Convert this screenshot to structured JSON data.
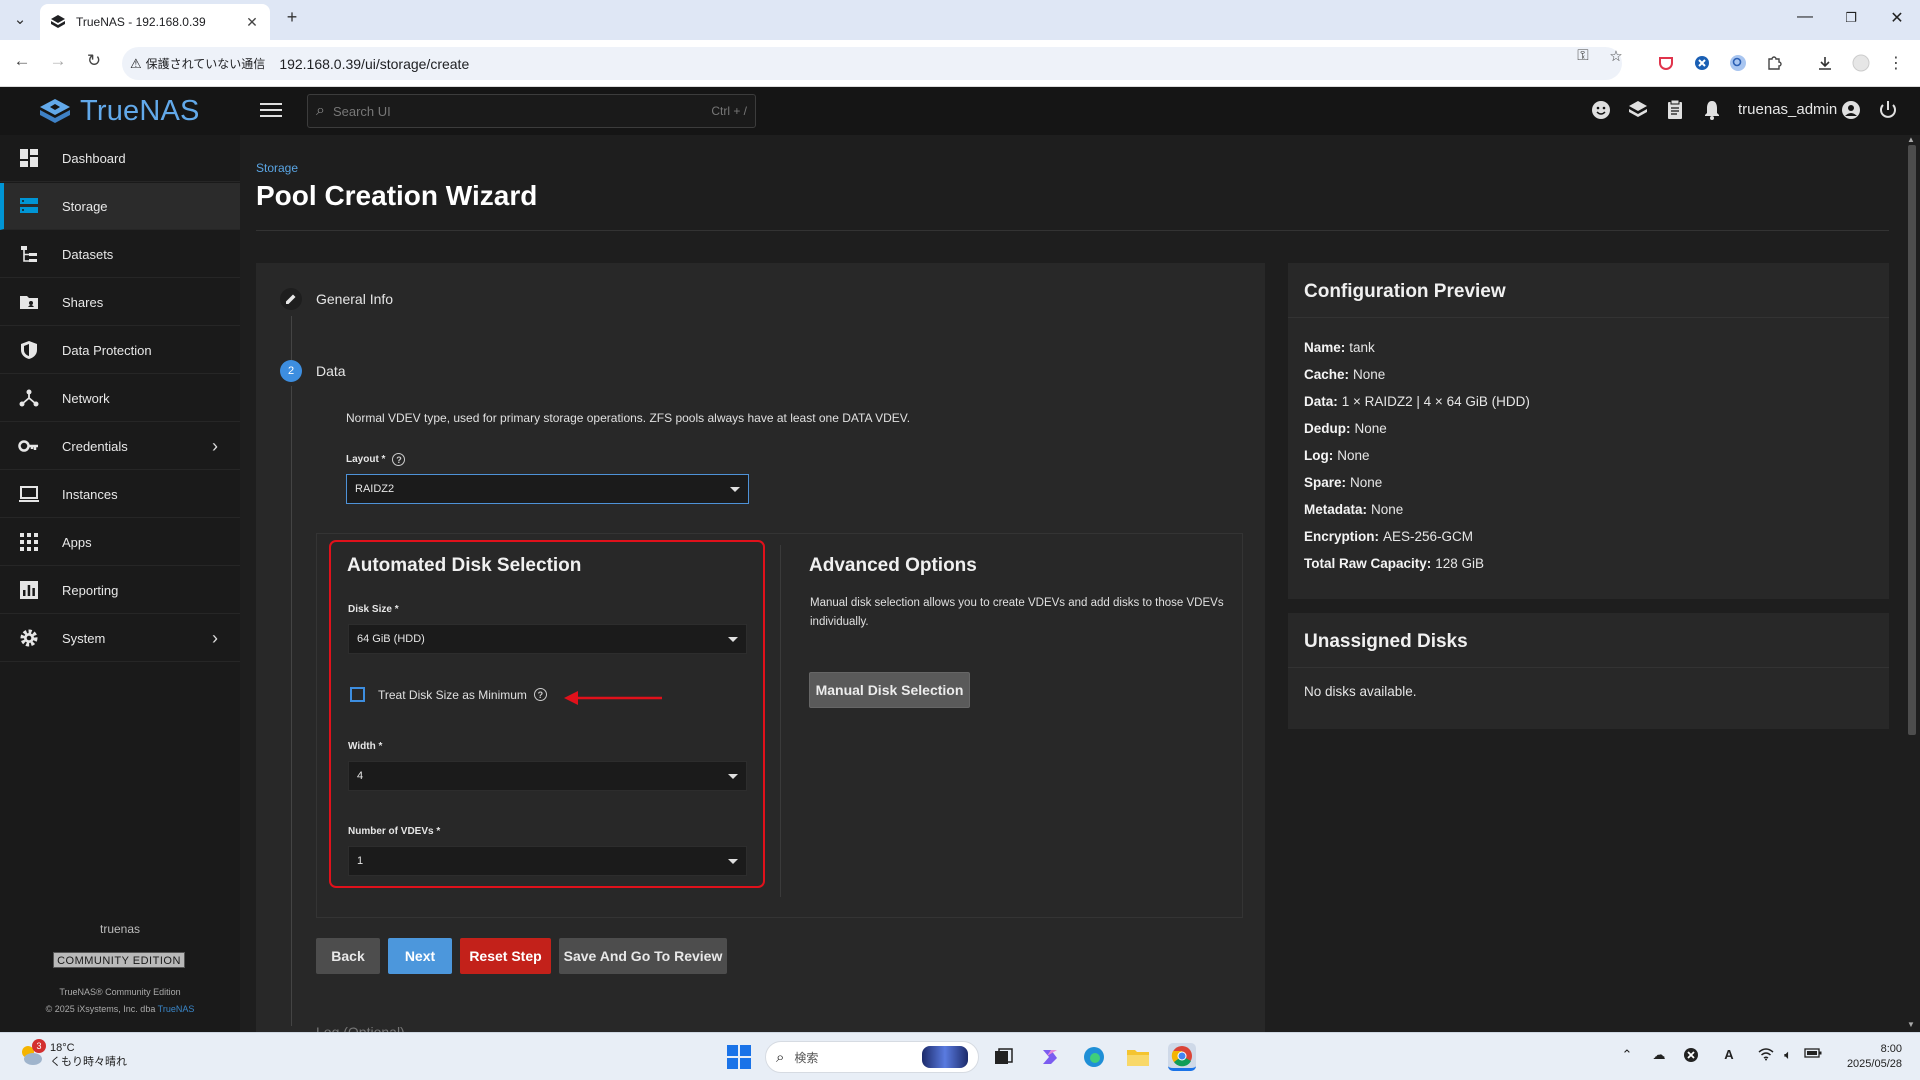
{
  "browser": {
    "tab_title": "TrueNAS - 192.168.0.39",
    "security_label": "保護されていない通信",
    "url": "192.168.0.39/ui/storage/create"
  },
  "topbar": {
    "logo_text": "TrueNAS",
    "search_placeholder": "Search UI",
    "search_shortcut": "Ctrl + /",
    "username": "truenas_admin"
  },
  "sidebar": {
    "items": [
      {
        "label": "Dashboard",
        "icon": "dashboard-icon"
      },
      {
        "label": "Storage",
        "icon": "storage-icon",
        "active": true
      },
      {
        "label": "Datasets",
        "icon": "datasets-icon"
      },
      {
        "label": "Shares",
        "icon": "shares-icon"
      },
      {
        "label": "Data Protection",
        "icon": "shield-icon"
      },
      {
        "label": "Network",
        "icon": "network-icon"
      },
      {
        "label": "Credentials",
        "icon": "key-icon",
        "has_submenu": true
      },
      {
        "label": "Instances",
        "icon": "laptop-icon"
      },
      {
        "label": "Apps",
        "icon": "apps-grid-icon"
      },
      {
        "label": "Reporting",
        "icon": "reporting-icon"
      },
      {
        "label": "System",
        "icon": "gear-icon",
        "has_submenu": true
      }
    ],
    "hostname": "truenas",
    "edition_badge": "COMMUNITY EDITION",
    "copyright_line1": "TrueNAS® Community Edition",
    "copyright_line2": "© 2025 iXsystems, Inc. dba",
    "copyright_link": "TrueNAS"
  },
  "page": {
    "breadcrumb": "Storage",
    "title": "Pool Creation Wizard"
  },
  "wizard": {
    "steps": [
      {
        "label": "General Info",
        "state": "completed"
      },
      {
        "number": "2",
        "label": "Data",
        "state": "active"
      }
    ],
    "next_step_partial": "Log (Optional)",
    "data_description": "Normal VDEV type, used for primary storage operations. ZFS pools always have at least one DATA VDEV.",
    "layout_label": "Layout *",
    "layout_value": "RAIDZ2",
    "automated": {
      "title": "Automated Disk Selection",
      "disk_size_label": "Disk Size *",
      "disk_size_value": "64 GiB (HDD)",
      "treat_min_label": "Treat Disk Size as Minimum",
      "treat_min_checked": false,
      "width_label": "Width *",
      "width_value": "4",
      "vdevs_label": "Number of VDEVs *",
      "vdevs_value": "1"
    },
    "advanced": {
      "title": "Advanced Options",
      "description": "Manual disk selection allows you to create VDEVs and add disks to those VDEVs individually.",
      "manual_button": "Manual Disk Selection"
    },
    "buttons": {
      "back": "Back",
      "next": "Next",
      "reset": "Reset Step",
      "save_review": "Save And Go To Review"
    }
  },
  "preview": {
    "title": "Configuration Preview",
    "rows": [
      {
        "key": "Name:",
        "value": "tank"
      },
      {
        "key": "Cache:",
        "value": "None"
      },
      {
        "key": "Data:",
        "value": "1 × RAIDZ2 | 4 × 64 GiB (HDD)"
      },
      {
        "key": "Dedup:",
        "value": "None"
      },
      {
        "key": "Log:",
        "value": "None"
      },
      {
        "key": "Spare:",
        "value": "None"
      },
      {
        "key": "Metadata:",
        "value": "None"
      },
      {
        "key": "Encryption:",
        "value": "AES-256-GCM"
      },
      {
        "key": "Total Raw Capacity:",
        "value": "128 GiB"
      }
    ]
  },
  "unassigned": {
    "title": "Unassigned Disks",
    "message": "No disks available."
  },
  "taskbar": {
    "weather_badge": "3",
    "temperature": "18°C",
    "weather_desc": "くもり時々晴れ",
    "search_placeholder": "検索",
    "time": "8:00",
    "date": "2025/05/28"
  },
  "colors": {
    "accent_blue": "#0095d5",
    "highlight_red": "#e0111b",
    "next_button": "#4c97dc",
    "reset_button": "#c3211a"
  }
}
